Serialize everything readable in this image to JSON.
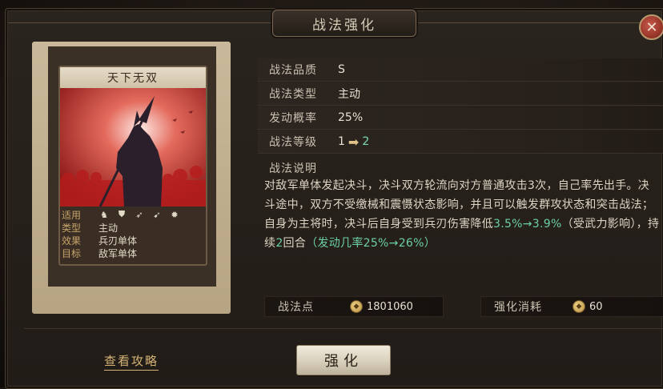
{
  "header": {
    "title": "战法强化"
  },
  "card": {
    "name": "天下无双",
    "props": {
      "applicable_label": "适用",
      "applicable_icons": [
        "cavalry-icon",
        "shield-icon",
        "archer-icon",
        "spear-icon",
        "siege-icon"
      ],
      "type_label": "类型",
      "type_value": "主动",
      "effect_label": "效果",
      "effect_value": "兵刃单体",
      "target_label": "目标",
      "target_value": "敌军单体"
    }
  },
  "info": {
    "quality_label": "战法品质",
    "quality_value": "S",
    "type_label": "战法类型",
    "type_value": "主动",
    "rate_label": "发动概率",
    "rate_value": "25%",
    "level_label": "战法等级",
    "level_from": "1",
    "level_to": "2"
  },
  "description": {
    "label": "战法说明",
    "part1": "对敌军单体发起决斗，决斗双方轮流向对方普通攻击3次，自己率先出手。决斗途中，双方不受缴械和震慑状态影响，并且可以触发群攻状态和突击战法；自身为主将时，决斗后自身受到兵刃伤害降低",
    "hl1": "3.5%→3.9%",
    "part2": "（受武力影响），持续",
    "hl2": "2",
    "part3": "回合",
    "hl3": "（发动几率25%→26%）"
  },
  "resources": {
    "points_label": "战法点",
    "points_value": "1801060",
    "cost_label": "强化消耗",
    "cost_value": "60"
  },
  "actions": {
    "guide_label": "查看攻略",
    "enhance_label": "强化"
  },
  "colors": {
    "accent_green": "#6ccfa6",
    "gold": "#d4b274",
    "frame": "#211c17"
  }
}
